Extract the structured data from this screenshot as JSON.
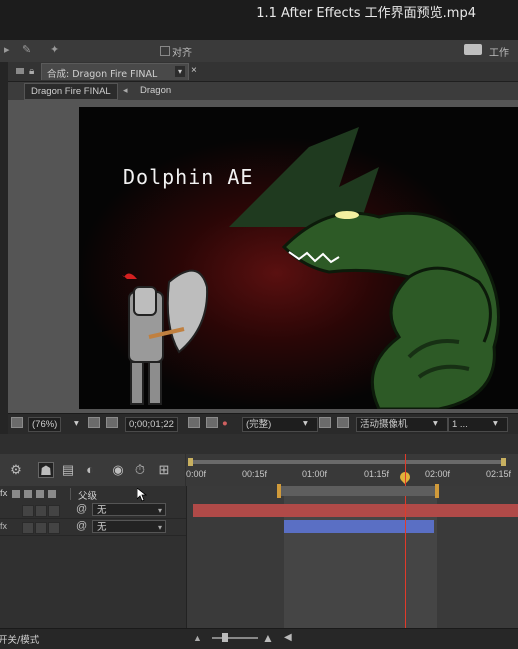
{
  "window": {
    "title": "1.1 After Effects 工作界面预览.mp4"
  },
  "toolbar": {
    "snap_label": "对齐",
    "workspace_label": "工作区"
  },
  "composition_panel": {
    "tab_label": "合成: Dragon Fire FINAL",
    "breadcrumb": [
      "Dragon Fire FINAL",
      "Dragon"
    ],
    "overlay_text": "Dolphin AE"
  },
  "viewer_controls": {
    "zoom": "(76%)",
    "timecode": "0;00;01;22",
    "resolution": "(完整)",
    "camera": "活动摄像机",
    "views": "1 ..."
  },
  "timeline": {
    "ruler_ticks": [
      "0:00f",
      "00:15f",
      "01:00f",
      "01:15f",
      "02:00f",
      "02:15f"
    ],
    "column_header": {
      "fx": "fx",
      "parent": "父级"
    },
    "layers": [
      {
        "fx": "",
        "parent": "无"
      },
      {
        "fx": "fx",
        "parent": "无"
      }
    ],
    "layer_bar_colors": [
      "#b04a48",
      "#5a6fc4"
    ]
  },
  "status_bar": {
    "toggle_label": "开关/模式"
  }
}
